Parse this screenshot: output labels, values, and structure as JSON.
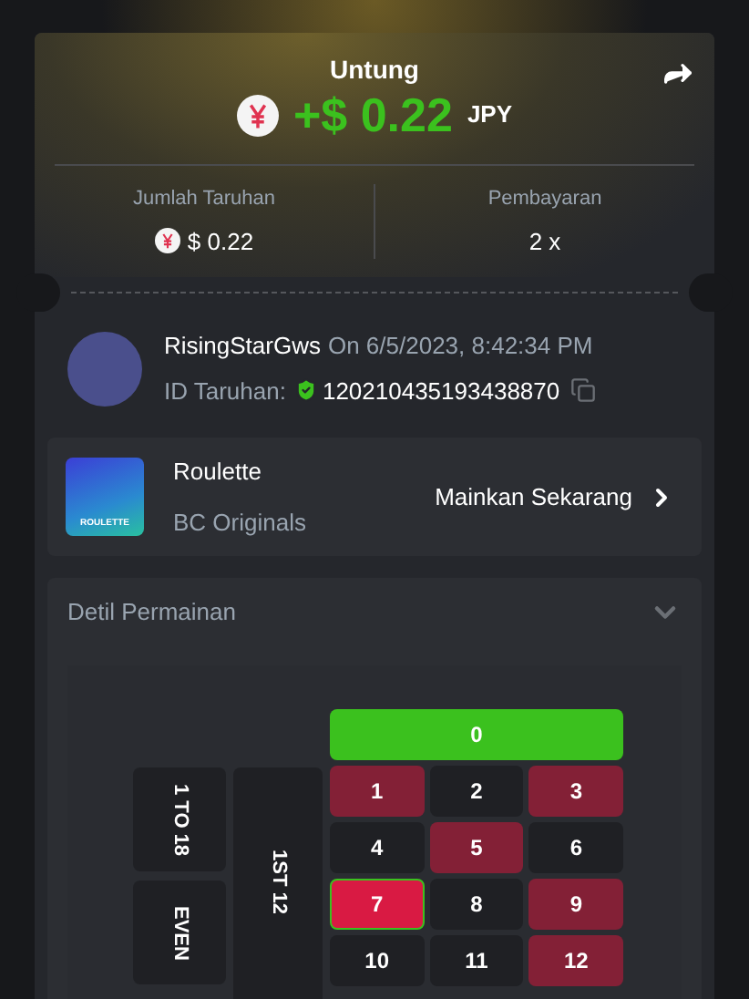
{
  "result": {
    "title": "Untung",
    "amount": "+$ 0.22",
    "currency": "JPY"
  },
  "stats": [
    {
      "label": "Jumlah Taruhan",
      "value": "$ 0.22",
      "coin": true
    },
    {
      "label": "Pembayaran",
      "value": "2 x",
      "coin": false
    }
  ],
  "player": {
    "name": "RisingStarGws",
    "time": "On 6/5/2023, 8:42:34 PM",
    "id_label": "ID Taruhan:",
    "id": "120210435193438870"
  },
  "game": {
    "title": "Roulette",
    "provider": "BC Originals",
    "thumb_text": "ROULETTE",
    "play": "Mainkan Sekarang"
  },
  "details": {
    "title": "Detil Permainan",
    "expanded": true,
    "zero": {
      "label": "0",
      "color": "#3bc11e"
    },
    "outside": [
      {
        "label": "1 TO 18"
      },
      {
        "label": "EVEN"
      }
    ],
    "dozen": {
      "label": "1ST 12"
    },
    "numbers": [
      {
        "label": "1",
        "color": "#832036",
        "selected": false
      },
      {
        "label": "2",
        "color": "#1f2024",
        "selected": false
      },
      {
        "label": "3",
        "color": "#832036",
        "selected": false
      },
      {
        "label": "4",
        "color": "#1f2024",
        "selected": false
      },
      {
        "label": "5",
        "color": "#832036",
        "selected": false
      },
      {
        "label": "6",
        "color": "#1f2024",
        "selected": false
      },
      {
        "label": "7",
        "color": "#d91a43",
        "selected": true
      },
      {
        "label": "8",
        "color": "#1f2024",
        "selected": false
      },
      {
        "label": "9",
        "color": "#832036",
        "selected": false
      },
      {
        "label": "10",
        "color": "#1f2024",
        "selected": false
      },
      {
        "label": "11",
        "color": "#1f2024",
        "selected": false
      },
      {
        "label": "12",
        "color": "#832036",
        "selected": false
      }
    ]
  }
}
